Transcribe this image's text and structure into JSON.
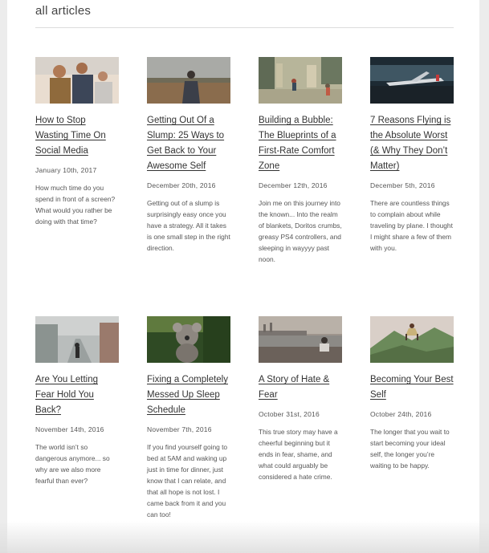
{
  "section": {
    "title": "all articles"
  },
  "articles": [
    {
      "title": "How to Stop Wasting Time On Social Media",
      "date": "January 10th, 2017",
      "excerpt": "How much time do you spend in front of a screen? What would you rather be doing with that time?",
      "image": "people-using-phones-photo"
    },
    {
      "title": "Getting Out Of a Slump: 25 Ways to Get Back to Your Awesome Self",
      "date": "December 20th, 2016",
      "excerpt": "Getting out of a slump is surprisingly easy once you have a strategy. All it takes is one small step in the right direction.",
      "image": "person-in-field-photo"
    },
    {
      "title": "Building a Bubble: The Blueprints of a First-Rate Comfort Zone",
      "date": "December 12th, 2016",
      "excerpt": "Join me on this journey into the known... Into the realm of blankets, Doritos crumbs, greasy PS4 controllers, and sleeping in wayyyy past noon.",
      "image": "city-street-photo"
    },
    {
      "title": "7 Reasons Flying is the Absolute Worst (& Why They Don’t Matter)",
      "date": "December 5th, 2016",
      "excerpt": "There are countless things to complain about while traveling by plane. I thought I might share a few of them with you.",
      "image": "airplane-photo"
    },
    {
      "title": "Are You Letting Fear Hold You Back?",
      "date": "November 14th, 2016",
      "excerpt": "The world isn’t so dangerous anymore... so why are we also more fearful than ever?",
      "image": "foggy-road-photo"
    },
    {
      "title": "Fixing a Completely Messed Up Sleep Schedule",
      "date": "November 7th, 2016",
      "excerpt": "If you find yourself going to bed at 5AM and waking up just in time for dinner, just know that I can relate, and that all hope is not lost. I came back from it and you can too!",
      "image": "koala-photo"
    },
    {
      "title": "A Story of Hate & Fear",
      "date": "October 31st, 2016",
      "excerpt": "This true story may have a cheerful beginning but it ends in fear, shame, and what could arguably be considered a hate crime.",
      "image": "man-by-water-photo"
    },
    {
      "title": "Becoming Your Best Self",
      "date": "October 24th, 2016",
      "excerpt": "The longer that you wait to start becoming your ideal self, the longer you’re waiting to be happy.",
      "image": "jumping-person-photo"
    }
  ]
}
